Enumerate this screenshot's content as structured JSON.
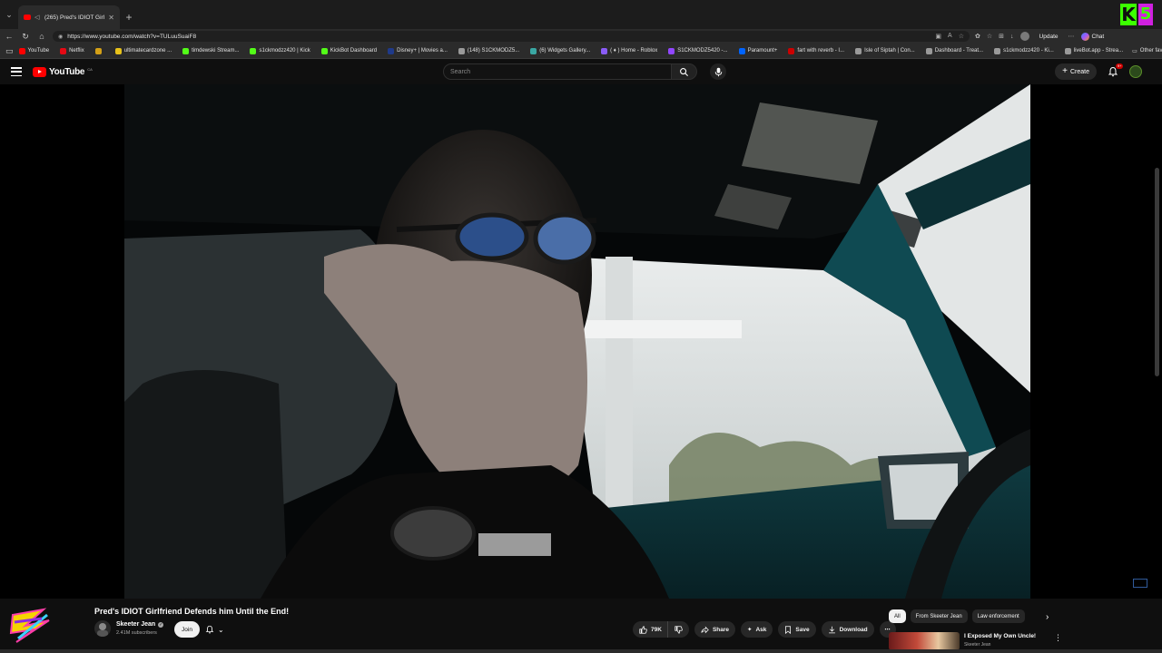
{
  "browser": {
    "tab_title": "(265) Pred's IDIOT Girlfriend D",
    "url": "https://www.youtube.com/watch?v=TULuuSuaiF8",
    "update_label": "Update",
    "chat_label": "Chat",
    "overlay_badge": {
      "k": "K",
      "five": "5"
    }
  },
  "bookmarks": [
    {
      "label": "YouTube",
      "color": "#ff0000"
    },
    {
      "label": "Netflix",
      "color": "#e50914"
    },
    {
      "label": "",
      "color": "#d4a017"
    },
    {
      "label": "ultimatecardzone ...",
      "color": "#e8c21a"
    },
    {
      "label": "timdewski Stream...",
      "color": "#53fc18"
    },
    {
      "label": "s1ckmodzz420 | Kick",
      "color": "#53fc18"
    },
    {
      "label": "KickBot Dashboard",
      "color": "#53fc18"
    },
    {
      "label": "Disney+ | Movies a...",
      "color": "#1f3a8a"
    },
    {
      "label": "(148) S1CKMODZ5...",
      "color": "#9a9a9a"
    },
    {
      "label": "(6) Widgets Gallery...",
      "color": "#3aa7a3"
    },
    {
      "label": "( ♦ ) Home - Roblox",
      "color": "#8a5cf6"
    },
    {
      "label": "S1CKMODZ5420 -...",
      "color": "#9146ff"
    },
    {
      "label": "Paramount+",
      "color": "#0064ff"
    },
    {
      "label": "fart with reverb - I...",
      "color": "#cc0000"
    },
    {
      "label": "Isle of Siptah | Con...",
      "color": "#9a9a9a"
    },
    {
      "label": "Dashboard - Treat...",
      "color": "#9a9a9a"
    },
    {
      "label": "s1ckmodzz420 - Ki...",
      "color": "#9a9a9a"
    },
    {
      "label": "liveBot.app - Strea...",
      "color": "#9a9a9a"
    }
  ],
  "bookmarks_other": "Other favorites",
  "youtube": {
    "logo_text": "YouTube",
    "country_code": "CA",
    "search_placeholder": "Search",
    "create_label": "Create",
    "notification_count": "9+"
  },
  "video": {
    "title": "Pred's IDIOT Girlfriend Defends him Until the End!",
    "channel": "Skeeter Jean",
    "subscribers": "2.41M subscribers",
    "join_label": "Join",
    "likes": "79K",
    "actions": {
      "share": "Share",
      "ask": "Ask",
      "save": "Save",
      "download": "Download"
    }
  },
  "chips": [
    "All",
    "From Skeeter Jean",
    "Law enforcement"
  ],
  "recommendation": {
    "title": "I Exposed My Own Uncle!",
    "channel": "Skeeter Jean"
  }
}
